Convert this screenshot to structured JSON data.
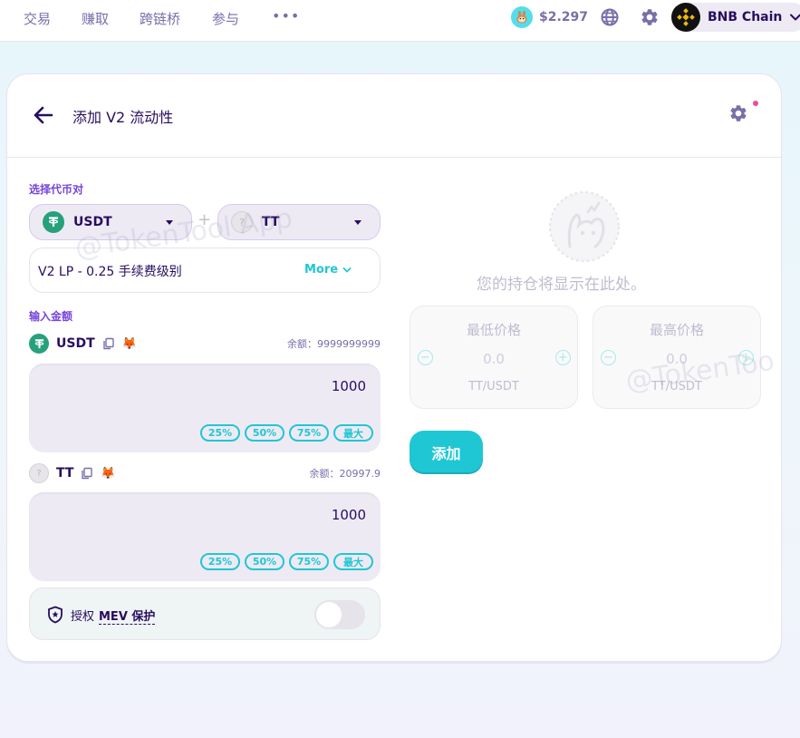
{
  "nav": {
    "items": [
      "交易",
      "赚取",
      "跨链桥",
      "参与"
    ],
    "more": "•••",
    "cake_price": "$2.297",
    "chain_name": "BNB Chain"
  },
  "header": {
    "title": "添加 V2 流动性"
  },
  "pair": {
    "label": "选择代币对",
    "token_a": "USDT",
    "token_b": "TT",
    "plus": "+"
  },
  "fee": {
    "text": "V2 LP - 0.25 手续费级别",
    "more": "More"
  },
  "amounts": {
    "label": "输入金额",
    "rows": [
      {
        "symbol": "USDT",
        "balance": "余额：9999999999",
        "value": "1000"
      },
      {
        "symbol": "TT",
        "balance": "余额：20997.9",
        "value": "1000"
      }
    ],
    "pct": [
      "25%",
      "50%",
      "75%",
      "最大"
    ]
  },
  "mev": {
    "authorize": "授权",
    "link": "MEV 保护",
    "enabled": false
  },
  "positions": {
    "empty_text": "您的持仓将显示在此处。"
  },
  "range": {
    "min_title": "最低价格",
    "max_title": "最高价格",
    "min_value": "0.0",
    "max_value": "0.0",
    "unit": "TT/USDT"
  },
  "add_button": "添加",
  "watermarks": [
    "@TokenTool App",
    "@TokenToo"
  ],
  "colors": {
    "primary": "#1fc7d4",
    "secondary": "#7645d9",
    "text": "#280d5f",
    "subtle": "#7a6eaa"
  },
  "icons": [
    "bunny-icon",
    "globe-icon",
    "gear-icon",
    "bnb-icon",
    "back-arrow-icon",
    "usdt-icon",
    "tt-icon",
    "copy-icon",
    "metamask-icon",
    "shield-icon",
    "chevron-down-icon"
  ]
}
